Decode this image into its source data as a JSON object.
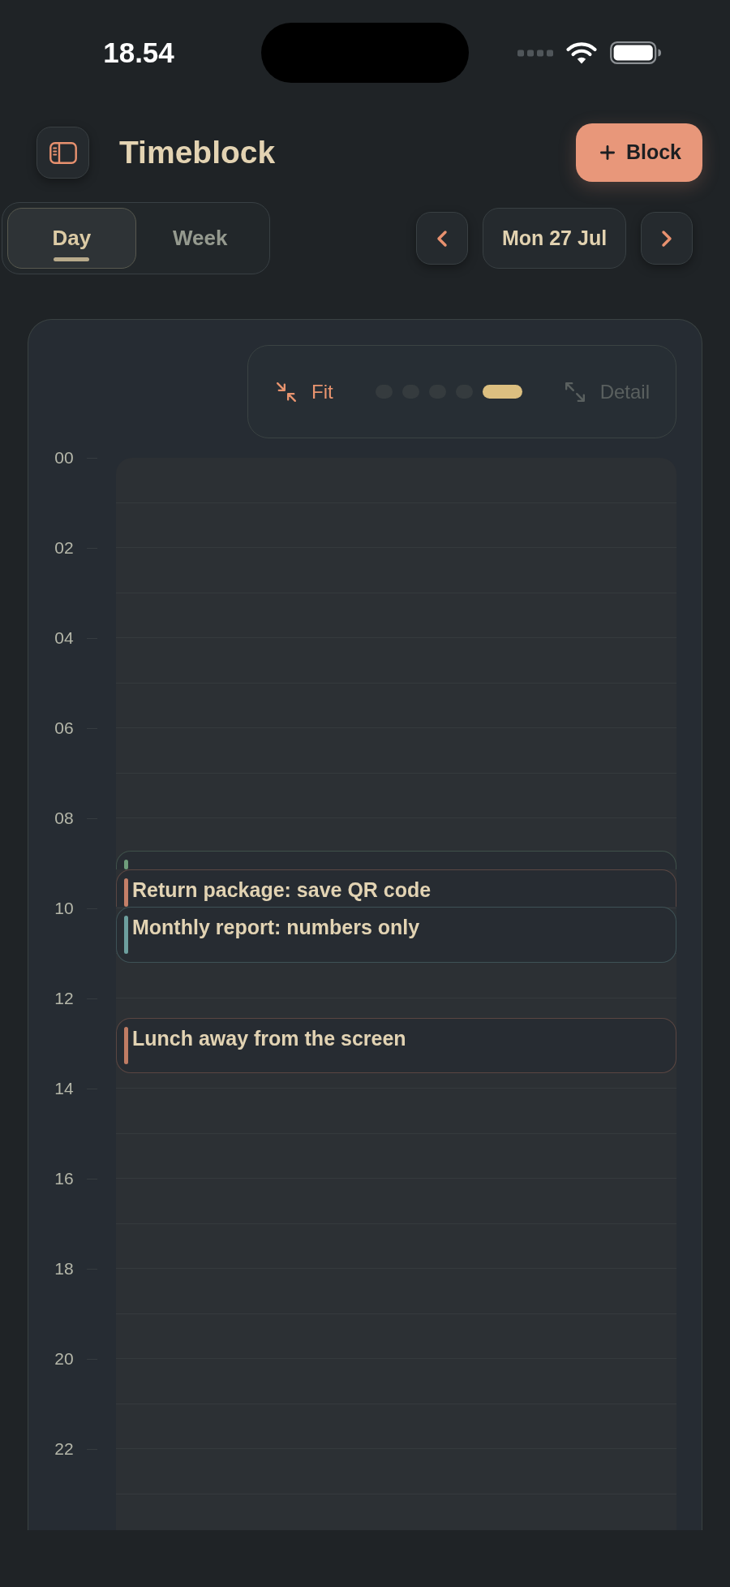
{
  "status_bar": {
    "time": "18.54"
  },
  "header": {
    "title": "Timeblock",
    "add_button": {
      "label": "Block"
    }
  },
  "view_tabs": [
    {
      "label": "Day",
      "selected": true
    },
    {
      "label": "Week",
      "selected": false
    }
  ],
  "date_nav": {
    "date": "Mon 27 Jul"
  },
  "zoom": {
    "fit": {
      "label": "Fit",
      "disabled": false
    },
    "steps": [
      {
        "selected": false
      },
      {
        "selected": false
      },
      {
        "selected": false
      },
      {
        "selected": false
      },
      {
        "selected": true
      }
    ],
    "detail": {
      "label": "Detail",
      "disabled": true
    }
  },
  "timeline": {
    "hour_labels": [
      "00",
      "02",
      "04",
      "06",
      "08",
      "10",
      "12",
      "14",
      "16",
      "18",
      "20",
      "22"
    ],
    "events": [
      {
        "color": "#6f9d7b"
      },
      {
        "title": "Return package: save QR code",
        "color": "#c47f68"
      },
      {
        "title": "Monthly report: numbers only",
        "color": "#6d9f9e"
      },
      {
        "title": "Lunch away from the screen",
        "color": "#bf7c64"
      }
    ]
  }
}
